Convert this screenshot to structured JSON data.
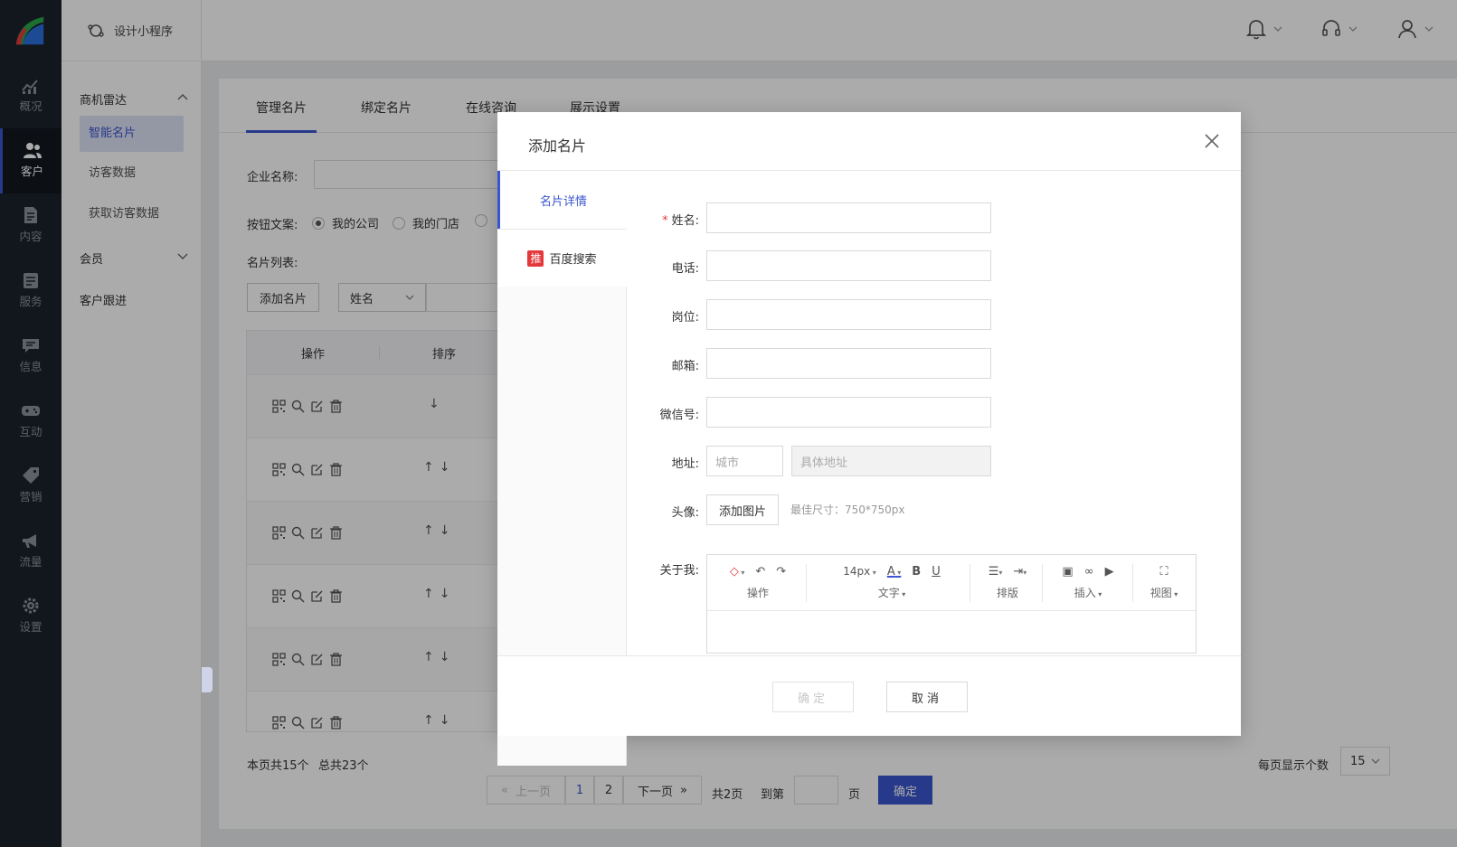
{
  "app": {
    "title": "设计小程序"
  },
  "rail": [
    {
      "label": "概况",
      "icon": "chart-icon"
    },
    {
      "label": "客户",
      "icon": "users-icon",
      "active": true
    },
    {
      "label": "内容",
      "icon": "document-icon"
    },
    {
      "label": "服务",
      "icon": "service-icon"
    },
    {
      "label": "信息",
      "icon": "message-icon"
    },
    {
      "label": "互动",
      "icon": "gamepad-icon"
    },
    {
      "label": "营销",
      "icon": "tag-icon"
    },
    {
      "label": "流量",
      "icon": "megaphone-icon"
    },
    {
      "label": "设置",
      "icon": "gear-icon"
    }
  ],
  "submenu": {
    "group1": "商机雷达",
    "items": [
      "智能名片",
      "访客数据",
      "获取访客数据"
    ],
    "group2": "会员",
    "group3": "客户跟进"
  },
  "tabs": [
    "管理名片",
    "绑定名片",
    "在线咨询",
    "展示设置"
  ],
  "main": {
    "company_label": "企业名称:",
    "button_text_label": "按钮文案:",
    "radio1": "我的公司",
    "radio2": "我的门店",
    "list_label": "名片列表:",
    "add_button": "添加名片",
    "select_value": "姓名",
    "col_ops": "操作",
    "col_sort": "排序"
  },
  "pager": {
    "page_count_text": "本页共15个",
    "total_text": "总共23个",
    "prev": "上一页",
    "page1": "1",
    "page2": "2",
    "next": "下一页",
    "total_pages": "共2页",
    "goto": "到第",
    "page_unit": "页",
    "confirm": "确定",
    "per_page_label": "每页显示个数",
    "per_page_value": "15"
  },
  "modal": {
    "title": "添加名片",
    "side_tab1": "名片详情",
    "side_tab2": "百度搜索",
    "side_badge": "推",
    "fields": {
      "name": "姓名:",
      "phone": "电话:",
      "position": "岗位:",
      "email": "邮箱:",
      "wechat": "微信号:",
      "address": "地址:",
      "avatar": "头像:",
      "about": "关于我:"
    },
    "city_placeholder": "城市",
    "address_placeholder": "具体地址",
    "add_image": "添加图片",
    "size_hint": "最佳尺寸：750*750px",
    "editor": {
      "font_size": "14px",
      "groups": [
        "操作",
        "文字",
        "排版",
        "插入",
        "视图"
      ]
    },
    "confirm": "确定",
    "cancel": "取消"
  },
  "colors": {
    "accent": "#3b55d0",
    "rail_bg": "#1b232c",
    "required": "#e4393c"
  }
}
